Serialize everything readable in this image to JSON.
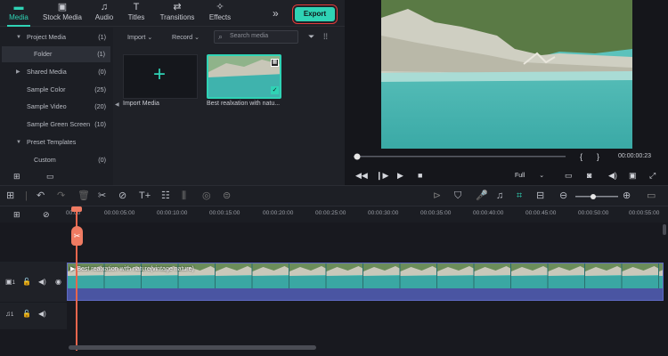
{
  "tabs": [
    {
      "label": "Media",
      "icon": "folder-icon"
    },
    {
      "label": "Stock Media",
      "icon": "image-icon"
    },
    {
      "label": "Audio",
      "icon": "music-icon"
    },
    {
      "label": "Titles",
      "icon": "text-icon"
    },
    {
      "label": "Transitions",
      "icon": "transition-icon"
    },
    {
      "label": "Effects",
      "icon": "effects-icon"
    }
  ],
  "more_label": "»",
  "export_label": "Export",
  "tree": [
    {
      "label": "Project Media",
      "count": "(1)"
    },
    {
      "label": "Folder",
      "count": "(1)"
    },
    {
      "label": "Shared Media",
      "count": "(0)"
    },
    {
      "label": "Sample Color",
      "count": "(25)"
    },
    {
      "label": "Sample Video",
      "count": "(20)"
    },
    {
      "label": "Sample Green Screen",
      "count": "(10)"
    },
    {
      "label": "Preset Templates",
      "count": ""
    },
    {
      "label": "Custom",
      "count": "(0)"
    }
  ],
  "media_bar": {
    "import": "Import",
    "record": "Record",
    "search_placeholder": "Search media"
  },
  "media_items": {
    "import_caption": "Import Media",
    "clip_caption": "Best realxation with natu..."
  },
  "preview": {
    "time": "00:00:00:23",
    "quality": "Full",
    "brace_open": "{",
    "brace_close": "}"
  },
  "ruler": [
    "00:00",
    "00:00:05:00",
    "00:00:10:00",
    "00:00:15:00",
    "00:00:20:00",
    "00:00:25:00",
    "00:00:30:00",
    "00:00:35:00",
    "00:00:40:00",
    "00:00:45:00",
    "00:00:50:00",
    "00:00:55:00"
  ],
  "video_track": {
    "number": "1",
    "clip_label": "Best realxation with nature(vintage nature)"
  },
  "audio_track": {
    "number": "1"
  },
  "colors": {
    "accent": "#2fd3b5",
    "playhead": "#e8664d",
    "clip_border": "#5e6ac4",
    "export_outline": "#e23a3a"
  }
}
